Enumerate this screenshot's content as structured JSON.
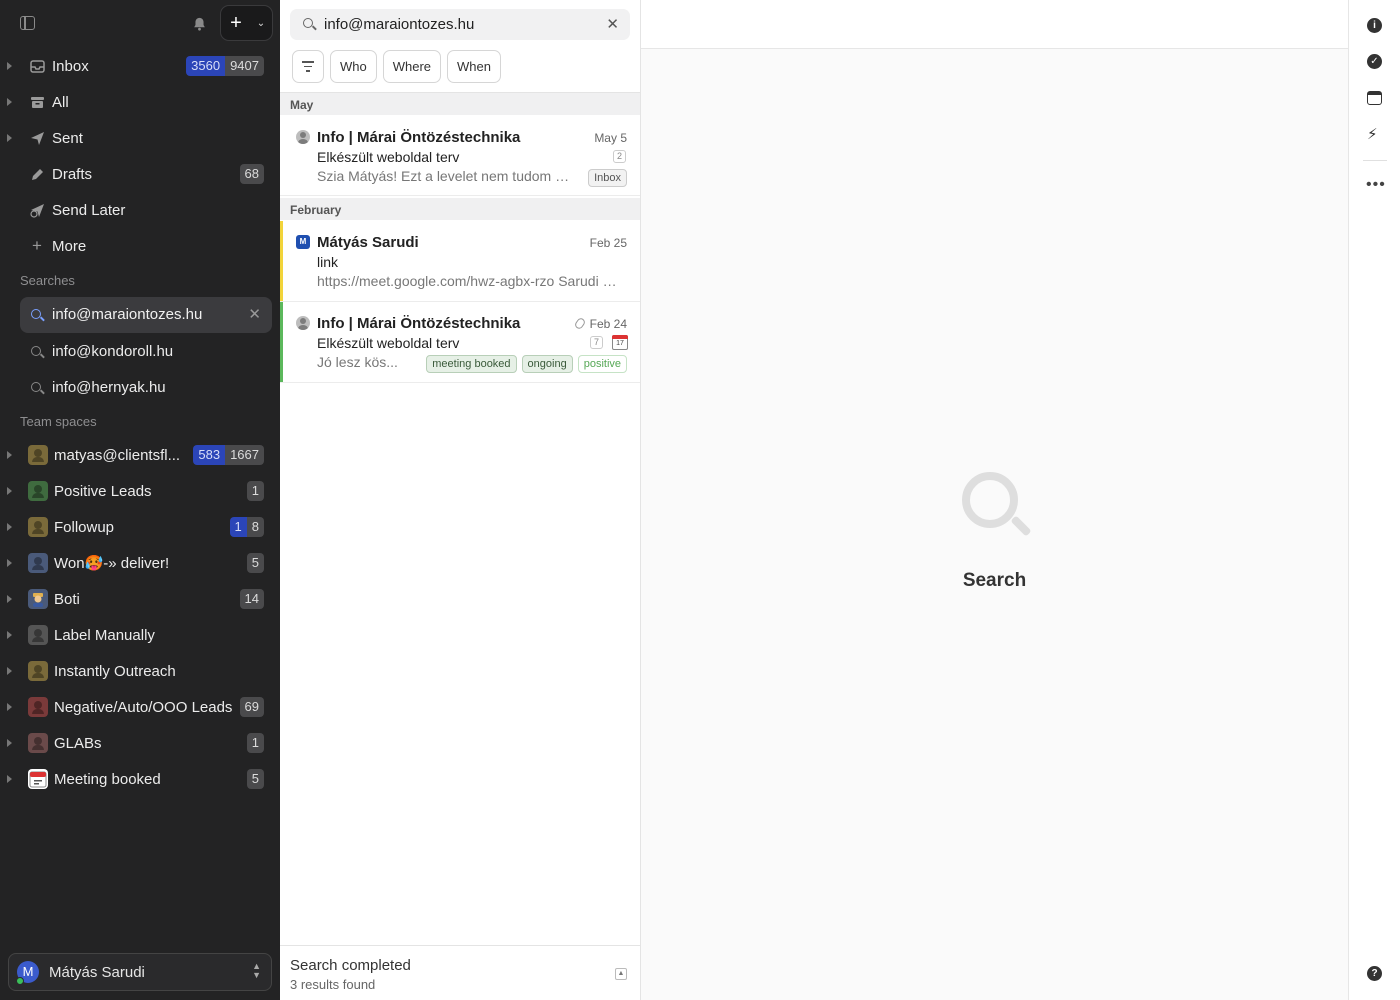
{
  "sidebar": {
    "nav": [
      {
        "label": "Inbox",
        "unread": "3560",
        "total": "9407",
        "icon": "inbox-icon"
      },
      {
        "label": "All",
        "icon": "archive-icon"
      },
      {
        "label": "Sent",
        "icon": "send-icon"
      },
      {
        "label": "Drafts",
        "total": "68",
        "icon": "pencil-icon"
      },
      {
        "label": "Send Later",
        "icon": "clock-send-icon"
      },
      {
        "label": "More",
        "icon": "plus-icon"
      }
    ],
    "searches_title": "Searches",
    "searches": [
      "info@maraiontozes.hu",
      "info@kondoroll.hu",
      "info@hernyak.hu"
    ],
    "team_title": "Team spaces",
    "teams": [
      {
        "label": "matyas@clientsfl...",
        "unread": "583",
        "total": "1667",
        "color": "#7a6a3a"
      },
      {
        "label": "Positive Leads",
        "total": "1",
        "color": "#3f6b3f"
      },
      {
        "label": "Followup",
        "unread": "1",
        "total": "8",
        "color": "#7a6a3a"
      },
      {
        "label": "Won🥵-» deliver!",
        "total": "5",
        "color": "#4a5a7a"
      },
      {
        "label": "Boti",
        "total": "14",
        "color": "#4a5a7a"
      },
      {
        "label": "Label Manually",
        "color": "#555555"
      },
      {
        "label": "Instantly Outreach",
        "color": "#7a6a3a"
      },
      {
        "label": "Negative/Auto/OOO Leads",
        "total": "69",
        "color": "#7a3a3a"
      },
      {
        "label": "GLABs",
        "total": "1",
        "color": "#6a4a4a"
      },
      {
        "label": "Meeting booked",
        "total": "5",
        "color": "#ffffff"
      }
    ],
    "user": {
      "initial": "M",
      "name": "Mátyás Sarudi"
    }
  },
  "list": {
    "query": "info@maraiontozes.hu",
    "filters": [
      "Who",
      "Where",
      "When"
    ],
    "groups": [
      {
        "name": "May"
      },
      {
        "name": "February"
      }
    ],
    "messages": [
      {
        "sender": "Info | Márai Öntözéstechnika",
        "date": "May 5",
        "subject": "Elkészült weboldal terv",
        "preview": "Szia Mátyás! Ezt a levelet nem tudom megnyitni",
        "count": "2",
        "tags": [
          "Inbox"
        ]
      },
      {
        "sender": "Mátyás Sarudi",
        "avatar": "M",
        "date": "Feb 25",
        "subject": "link",
        "preview": "https://meet.google.com/hwz-agbx-rzo Sarudi Mátyás",
        "accent": "#f2d43a"
      },
      {
        "sender": "Info | Márai Öntözéstechnika",
        "date": "Feb 24",
        "subject": "Elkészült weboldal terv",
        "preview": "Jó lesz kös...",
        "count": "7",
        "tags": [
          "meeting booked",
          "ongoing",
          "positive"
        ],
        "accent": "#5cb85c",
        "calendar": "17"
      }
    ],
    "status": {
      "title": "Search completed",
      "detail": "3 results found"
    }
  },
  "content": {
    "empty_title": "Search"
  },
  "colors": {
    "sidebar_bg": "#232324",
    "badge_blue": "#2b45b8",
    "accent_green": "#5cb85c",
    "accent_yellow": "#f2d43a"
  }
}
